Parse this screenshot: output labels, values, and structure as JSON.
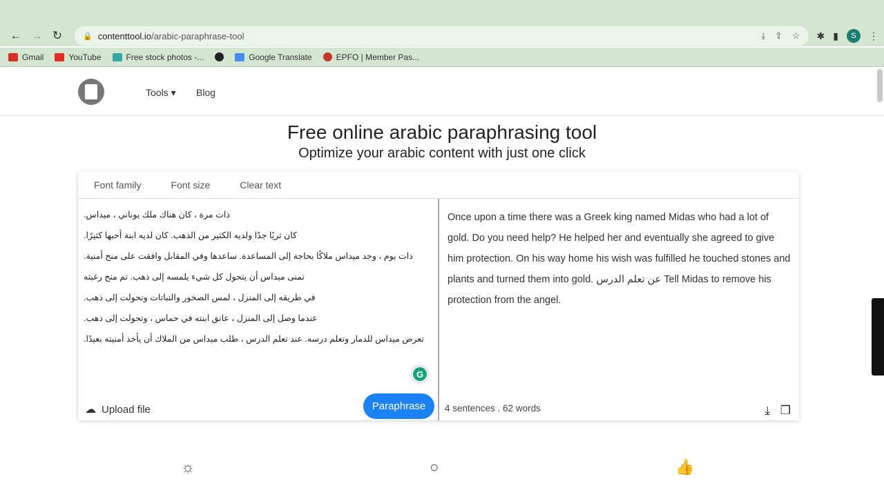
{
  "browser": {
    "url_host": "contenttool.io",
    "url_path": "/arabic-paraphrase-tool",
    "profile_initial": "S",
    "bookmarks": [
      {
        "label": "Gmail",
        "color": "#d93025"
      },
      {
        "label": "YouTube",
        "color": "#e52d27"
      },
      {
        "label": "Free stock photos -...",
        "color": "#3aa5a5"
      },
      {
        "label": "",
        "color": "#222"
      },
      {
        "label": "Google Translate",
        "color": "#4a8af4"
      },
      {
        "label": "EPFO | Member Pas...",
        "color": "#c0392b"
      }
    ]
  },
  "header": {
    "tools": "Tools ▾",
    "blog": "Blog"
  },
  "hero": {
    "title": "Free online arabic paraphrasing tool",
    "subtitle": "Optimize your arabic content with just one click"
  },
  "editor": {
    "font_family": "Font family",
    "font_size": "Font size",
    "clear_text": "Clear text",
    "input_lines": [
      "ذات مرة ، كان هناك ملك يوناني ، ميداس.",
      "كان ثريًا جدًا ولديه الكثير من الذهب. كان لديه ابنة أحبها كثيرًا.",
      "ذات يوم ، وجد ميداس ملاكًا بحاجة إلى المساعدة. ساعدها وفي المقابل وافقت على منح أمنية.",
      "تمنى ميداس أن يتحول كل شيء يلمسه إلى ذهب. تم منح رغبته",
      "في طريقه إلى المنزل ، لمس الصخور والنباتات وتحولت إلى ذهب.",
      "عندما وصل إلى المنزل ، عانق ابنته في حماس ، وتحولت إلى ذهب.",
      "تعرض ميداس للدمار وتعلم درسه. عند تعلم الدرس ، طلب ميداس من الملاك أن يأخذ أمنيته بعيدًا."
    ],
    "output": "Once upon a time there was a Greek king named Midas who had a lot of gold. Do you need help? He helped her and eventually she agreed to give him protection. On his way home his wish was fulfilled he touched stones and plants and turned them into gold. عن تعلم الدرس Tell Midas to remove his protection from the angel.",
    "upload": "Upload file",
    "paraphrase": "Paraphrase",
    "stats": "4 sentences . 62 words",
    "grammarly": "G"
  },
  "accent": "#1a82f2"
}
